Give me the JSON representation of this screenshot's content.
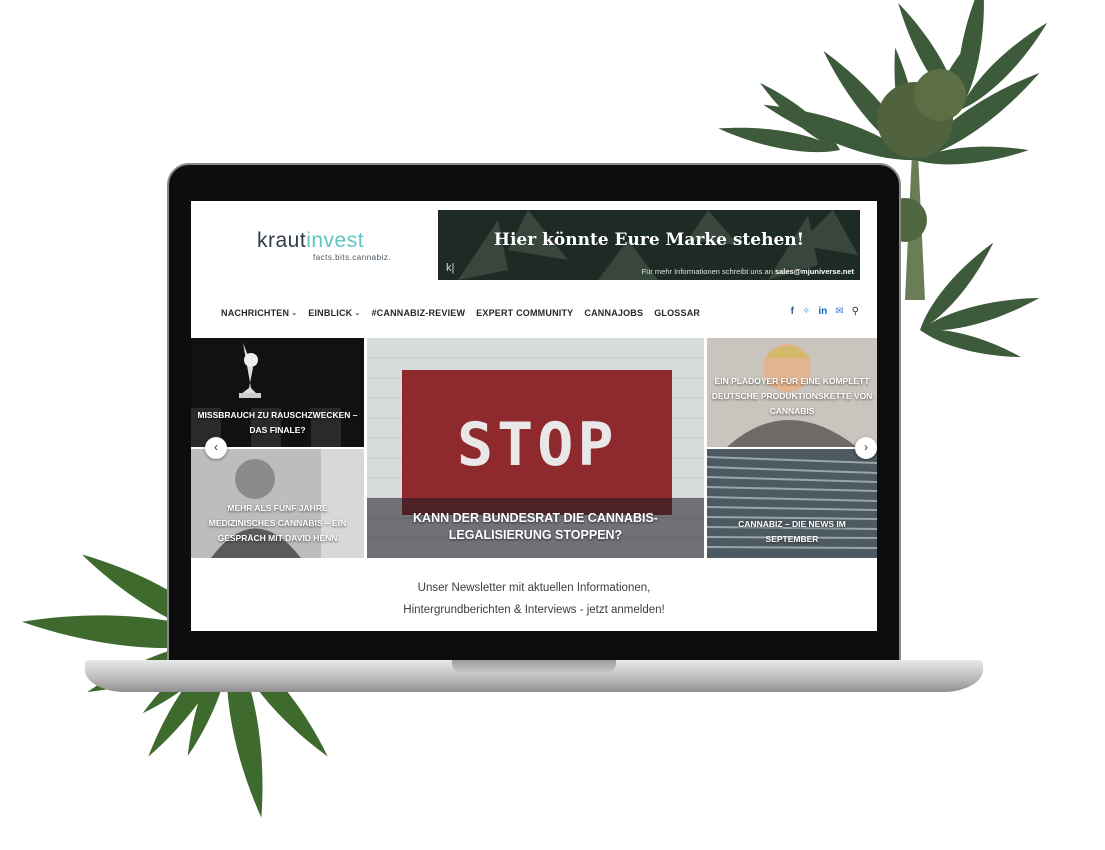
{
  "site": {
    "logo_main": "kraut",
    "logo_accent": "invest",
    "logo_tagline": "facts.bits.cannabiz."
  },
  "banner": {
    "headline": "Hier könnte Eure Marke stehen!",
    "sub_prefix": "Für mehr Informationen schreibt uns an ",
    "sub_email": "sales@mjuniverse.net",
    "brand_mark": "k|"
  },
  "nav": {
    "items": [
      {
        "label": "NACHRICHTEN",
        "has_dropdown": true
      },
      {
        "label": "EINBLICK",
        "has_dropdown": true
      },
      {
        "label": "#CANNABIZ-REVIEW",
        "has_dropdown": false
      },
      {
        "label": "EXPERT COMMUNITY",
        "has_dropdown": false
      },
      {
        "label": "CANNAJOBS",
        "has_dropdown": false
      },
      {
        "label": "GLOSSAR",
        "has_dropdown": false
      }
    ],
    "social_icons": [
      "facebook-icon",
      "twitter-icon",
      "linkedin-icon",
      "mail-icon",
      "search-icon"
    ]
  },
  "slider": {
    "prev_icon": "chevron-left-icon",
    "next_icon": "chevron-right-icon",
    "tiles": [
      {
        "title": "MISSBRAUCH ZU RAUSCHZWECKEN – DAS FINALE?"
      },
      {
        "title": "MEHR ALS FÜNF JAHRE MEDIZINISCHES CANNABIS – EIN GESPRÄCH MIT DAVID HENN"
      },
      {
        "title": "KANN DER BUNDESRAT DIE CANNABIS-LEGALISIERUNG STOPPEN?",
        "image_text": "STOP"
      },
      {
        "title": "EIN PLÄDOYER FÜR EINE KOMPLETT DEUTSCHE PRODUKTIONSKETTE VON CANNABIS"
      },
      {
        "title": "CANNABIZ – DIE NEWS IM SEPTEMBER"
      }
    ]
  },
  "newsletter": {
    "line1": "Unser Newsletter mit aktuellen Informationen,",
    "line2": "Hintergrundberichten & Interviews - jetzt anmelden!"
  },
  "colors": {
    "accent": "#5fc6c2",
    "nav_text": "#22282e",
    "stop_red": "#8e2a2e"
  }
}
